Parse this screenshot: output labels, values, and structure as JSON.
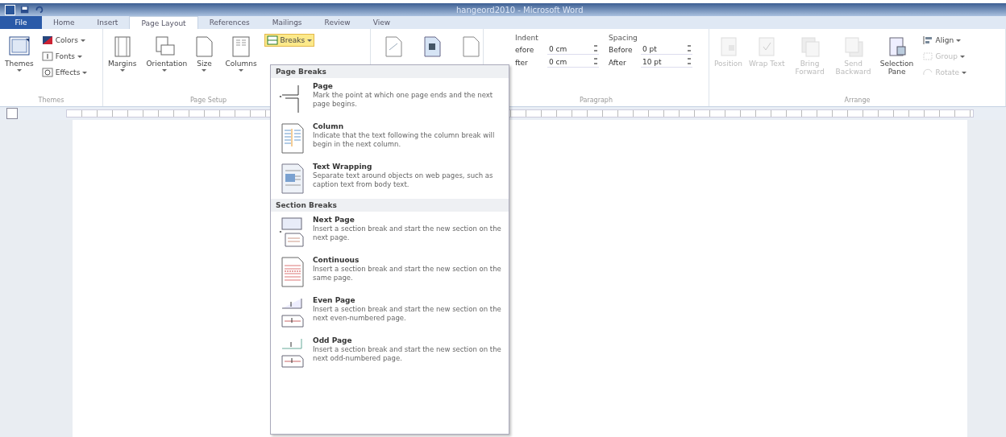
{
  "window": {
    "title": "hangeord2010 - Microsoft Word"
  },
  "tabs": [
    {
      "label": "File",
      "kind": "file",
      "selected": false
    },
    {
      "label": "Home",
      "kind": "tab",
      "selected": false
    },
    {
      "label": "Insert",
      "kind": "tab",
      "selected": false
    },
    {
      "label": "Page Layout",
      "kind": "tab",
      "selected": true
    },
    {
      "label": "References",
      "kind": "tab",
      "selected": false
    },
    {
      "label": "Mailings",
      "kind": "tab",
      "selected": false
    },
    {
      "label": "Review",
      "kind": "tab",
      "selected": false
    },
    {
      "label": "View",
      "kind": "tab",
      "selected": false
    }
  ],
  "ribbon": [
    {
      "label": "Themes",
      "items": [
        {
          "kind": "large",
          "label": "Themes",
          "dropdown": true
        },
        {
          "kind": "stack",
          "items": [
            {
              "label": "Colors",
              "dropdown": true
            },
            {
              "label": "Fonts",
              "dropdown": true
            },
            {
              "label": "Effects",
              "dropdown": true
            }
          ]
        }
      ]
    },
    {
      "label": "Page Setup",
      "items": [
        {
          "kind": "large",
          "label": "Margins",
          "dropdown": true
        },
        {
          "kind": "large",
          "label": "Orientation",
          "dropdown": true
        },
        {
          "kind": "large",
          "label": "Size",
          "dropdown": true
        },
        {
          "kind": "large",
          "label": "Columns",
          "dropdown": true
        },
        {
          "kind": "stack",
          "items": [
            {
              "label": "Breaks",
              "dropdown": true,
              "open": true
            }
          ]
        }
      ]
    },
    {
      "items": [
        {
          "kind": "large"
        },
        {
          "kind": "large"
        },
        {
          "kind": "large"
        }
      ]
    },
    {
      "label": "Paragraph",
      "items": [
        {
          "kind": "spinners",
          "heading": "Indent",
          "rows": [
            {
              "label": "efore",
              "value": "0 cm"
            },
            {
              "label": "fter",
              "value": "0 cm"
            }
          ]
        },
        {
          "kind": "spinners",
          "heading": "Spacing",
          "rows": [
            {
              "label": "Before",
              "value": "0 pt"
            },
            {
              "label": "After",
              "value": "10 pt"
            }
          ]
        }
      ]
    },
    {
      "label": "Arrange",
      "items": [
        {
          "kind": "large",
          "label": "Position",
          "dropdown": false,
          "disabled": true
        },
        {
          "kind": "large",
          "label": "Wrap Text",
          "dropdown": false,
          "disabled": true
        },
        {
          "kind": "large",
          "label": "Bring Forward",
          "dropdown": false,
          "disabled": true
        },
        {
          "kind": "large",
          "label": "Send Backward",
          "dropdown": false,
          "disabled": true
        },
        {
          "kind": "large",
          "label": "Selection Pane",
          "dropdown": false,
          "disabled": false
        },
        {
          "kind": "stack",
          "items": [
            {
              "label": "Align",
              "dropdown": true,
              "disabled": false
            },
            {
              "label": "Group",
              "dropdown": true,
              "disabled": true
            },
            {
              "label": "Rotate",
              "dropdown": true,
              "disabled": true
            }
          ]
        }
      ]
    }
  ],
  "breaks_menu": [
    {
      "heading": "Page Breaks",
      "entries": [
        {
          "title": "Page",
          "description": "Mark the point at which one page ends and the next page begins."
        },
        {
          "title": "Column",
          "description": "Indicate that the text following the column break will begin in the next column."
        },
        {
          "title": "Text Wrapping",
          "description": "Separate text around objects on web pages, such as caption text from body text."
        }
      ]
    },
    {
      "heading": "Section Breaks",
      "entries": [
        {
          "title": "Next Page",
          "description": "Insert a section break and start the new section on the next page."
        },
        {
          "title": "Continuous",
          "description": "Insert a section break and start the new section on the same page."
        },
        {
          "title": "Even Page",
          "description": "Insert a section break and start the new section on the next even-numbered page."
        },
        {
          "title": "Odd Page",
          "description": "Insert a section break and start the new section on the next odd-numbered page."
        }
      ]
    }
  ]
}
